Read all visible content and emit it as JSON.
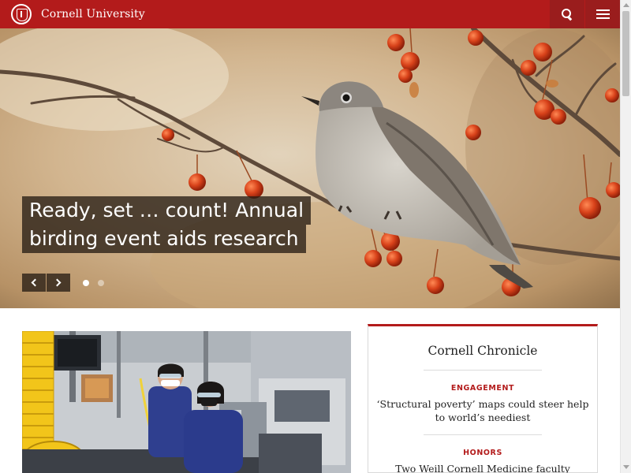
{
  "header": {
    "brand": "Cornell University",
    "accent": "#b31b1b",
    "button_color": "#9a1d1d",
    "icons": {
      "seal": "cornell-seal-icon",
      "search": "search-icon",
      "menu": "menu-icon"
    }
  },
  "hero": {
    "title_lines": [
      "Ready, set … count! Annual",
      "birding event aids research"
    ],
    "icons": {
      "prev": "chevron-left-icon",
      "next": "chevron-right-icon"
    },
    "slides": 2,
    "active_slide": 1
  },
  "chronicle": {
    "title": "Cornell Chronicle",
    "stories": [
      {
        "kicker": "ENGAGEMENT",
        "headline": "‘Structural poverty’ maps could steer help to world’s neediest"
      },
      {
        "kicker": "HONORS",
        "headline": "Two Weill Cornell Medicine faculty"
      }
    ]
  }
}
